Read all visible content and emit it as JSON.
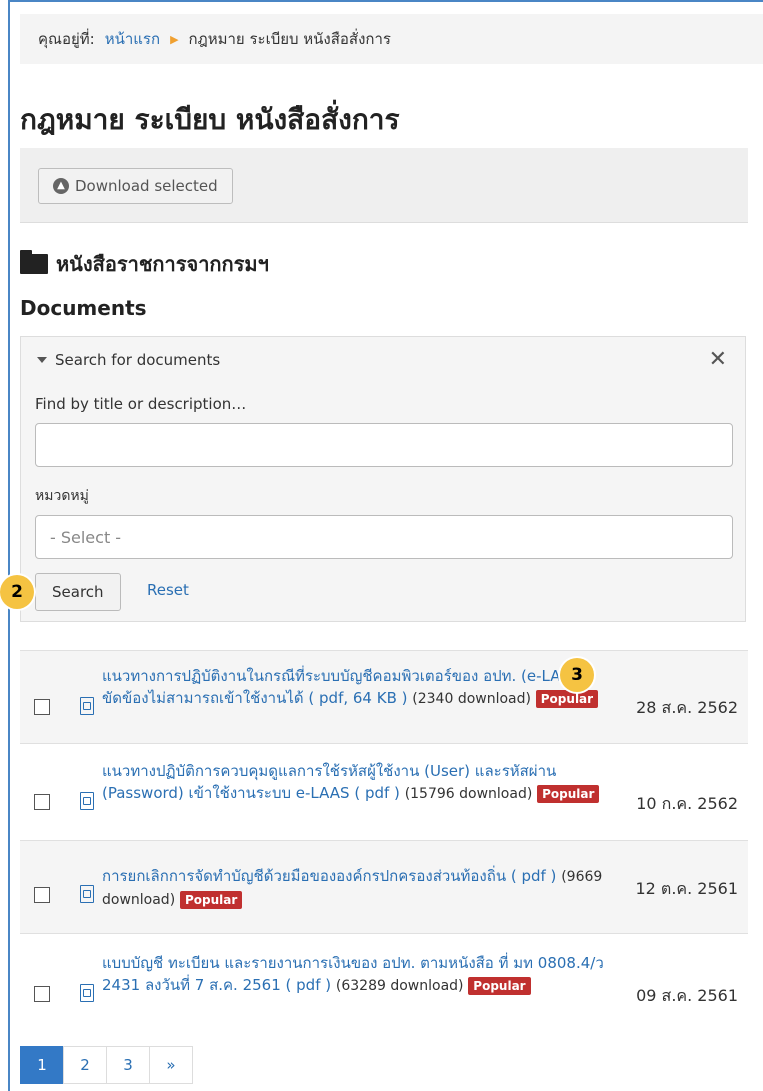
{
  "breadcrumb": {
    "prefix": "คุณอยู่ที่:",
    "home": "หน้าแรก",
    "current": "กฎหมาย ระเบียบ หนังสือสั่งการ"
  },
  "page_title": "กฎหมาย ระเบียบ หนังสือสั่งการ",
  "toolbar": {
    "download_label": "Download selected"
  },
  "category_title": "หนังสือราชการจากกรมฯ",
  "documents_heading": "Documents",
  "search": {
    "header": "Search for documents",
    "title_label": "Find by title or description…",
    "title_value": "",
    "category_label": "หมวดหมู่",
    "category_value": "- Select -",
    "search_label": "Search",
    "reset_label": "Reset"
  },
  "markers": {
    "a": "2",
    "b": "3"
  },
  "documents": [
    {
      "title": "แนวทางการปฏิบัติงานในกรณีที่ระบบบัญชีคอมพิวเตอร์ของ อปท. (e-LAAS) ขัดข้องไม่สามารถเข้าใช้งานได้ ( pdf, 64 KB )",
      "downloads": "(2340 download)",
      "popular": "Popular",
      "date": "28 ส.ค. 2562"
    },
    {
      "title": "แนวทางปฏิบัติการควบคุมดูแลการใช้รหัสผู้ใช้งาน (User) และรหัสผ่าน (Password) เข้าใช้งานระบบ e-LAAS ( pdf )",
      "downloads": "(15796 download)",
      "popular": "Popular",
      "date": "10 ก.ค. 2562"
    },
    {
      "title": "การยกเลิกการจัดทำบัญชีด้วยมือขององค์กรปกครองส่วนท้องถิ่น ( pdf )",
      "downloads": "(9669 download)",
      "popular": "Popular",
      "date": "12 ต.ค. 2561"
    },
    {
      "title": "แบบบัญชี ทะเบียน และรายงานการเงินของ อปท. ตามหนังสือ ที่ มท 0808.4/ว 2431 ลงวันที่ 7 ส.ค. 2561 ( pdf )",
      "downloads": "(63289 download)",
      "popular": "Popular",
      "date": "09 ส.ค. 2561"
    }
  ],
  "pager": {
    "pages": [
      "1",
      "2",
      "3"
    ],
    "next": "»"
  },
  "colors": {
    "link": "#2a6fb3",
    "popular": "#c0302f",
    "active_page": "#3379c6",
    "marker": "#f5c342"
  }
}
